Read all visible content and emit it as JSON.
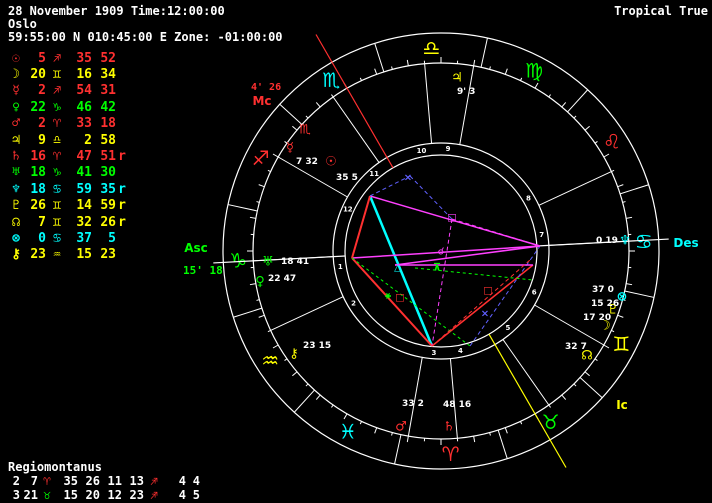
{
  "header": {
    "line1": "28 November 1909 Time:12:00:00",
    "line2": "Oslo",
    "line3": "59:55:00 N 010:45:00 E Zone: -01:00:00",
    "mode": "Tropical True"
  },
  "planets": [
    {
      "glyph": "☉",
      "color": "#ff3030",
      "deg": "5",
      "sign": "♐",
      "sign_color": "#ff3030",
      "min": "35",
      "sec": "52",
      "r": ""
    },
    {
      "glyph": "☽",
      "color": "#ffff00",
      "deg": "20",
      "sign": "♊",
      "sign_color": "#ffff00",
      "min": "16",
      "sec": "34",
      "r": ""
    },
    {
      "glyph": "☿",
      "color": "#ff3030",
      "deg": "2",
      "sign": "♐",
      "sign_color": "#ff3030",
      "min": "54",
      "sec": "31",
      "r": ""
    },
    {
      "glyph": "♀",
      "color": "#00ff00",
      "deg": "22",
      "sign": "♑",
      "sign_color": "#00ff00",
      "min": "46",
      "sec": "42",
      "r": ""
    },
    {
      "glyph": "♂",
      "color": "#ff3030",
      "deg": "2",
      "sign": "♈",
      "sign_color": "#ff3030",
      "min": "33",
      "sec": "18",
      "r": ""
    },
    {
      "glyph": "♃",
      "color": "#ffff00",
      "deg": "9",
      "sign": "♎",
      "sign_color": "#ffff00",
      "min": "2",
      "sec": "58",
      "r": ""
    },
    {
      "glyph": "♄",
      "color": "#ff3030",
      "deg": "16",
      "sign": "♈",
      "sign_color": "#ff3030",
      "min": "47",
      "sec": "51",
      "r": "r"
    },
    {
      "glyph": "♅",
      "color": "#00ff00",
      "deg": "18",
      "sign": "♑",
      "sign_color": "#00ff00",
      "min": "41",
      "sec": "30",
      "r": ""
    },
    {
      "glyph": "♆",
      "color": "#00ffff",
      "deg": "18",
      "sign": "♋",
      "sign_color": "#00ffff",
      "min": "59",
      "sec": "35",
      "r": "r"
    },
    {
      "glyph": "♇",
      "color": "#ffff00",
      "deg": "26",
      "sign": "♊",
      "sign_color": "#ffff00",
      "min": "14",
      "sec": "59",
      "r": "r"
    },
    {
      "glyph": "☊",
      "color": "#ffff00",
      "deg": "7",
      "sign": "♊",
      "sign_color": "#ffff00",
      "min": "32",
      "sec": "26",
      "r": "r"
    },
    {
      "glyph": "⊗",
      "color": "#00ffff",
      "deg": "0",
      "sign": "♋",
      "sign_color": "#00ffff",
      "min": "37",
      "sec": "5",
      "r": ""
    },
    {
      "glyph": "⚷",
      "color": "#ffff00",
      "deg": "23",
      "sign": "♒",
      "sign_color": "#ffff00",
      "min": "15",
      "sec": "23",
      "r": ""
    }
  ],
  "house_system": "Regiomontanus",
  "house_rows": [
    [
      {
        "text": "2",
        "color": "#ffffff"
      },
      {
        "text": "7",
        "color": "#ffffff"
      },
      {
        "text": "♈",
        "color": "#ff3030"
      },
      {
        "text": "35",
        "color": "#ffffff"
      },
      {
        "text": "26",
        "color": "#ffffff"
      },
      {
        "text": "11",
        "color": "#ffffff"
      },
      {
        "text": "13",
        "color": "#ffffff"
      },
      {
        "text": "♐",
        "color": "#ff3030"
      },
      {
        "text": "4",
        "color": "#ffffff"
      },
      {
        "text": "4",
        "color": "#ffffff"
      }
    ],
    [
      {
        "text": "3",
        "color": "#ffffff"
      },
      {
        "text": "21",
        "color": "#ffffff"
      },
      {
        "text": "♉",
        "color": "#00ff00"
      },
      {
        "text": "15",
        "color": "#ffffff"
      },
      {
        "text": "20",
        "color": "#ffffff"
      },
      {
        "text": "12",
        "color": "#ffffff"
      },
      {
        "text": "23",
        "color": "#ffffff"
      },
      {
        "text": "♐",
        "color": "#ff3030"
      },
      {
        "text": "4",
        "color": "#ffffff"
      },
      {
        "text": "5",
        "color": "#ffffff"
      }
    ]
  ],
  "wheel": {
    "signs": [
      {
        "glyph": "♈",
        "color": "#ff3030"
      },
      {
        "glyph": "♉",
        "color": "#00ff00"
      },
      {
        "glyph": "♊",
        "color": "#ffff00"
      },
      {
        "glyph": "♋",
        "color": "#00ffff"
      },
      {
        "glyph": "♌",
        "color": "#ff3030"
      },
      {
        "glyph": "♍",
        "color": "#00ff00"
      },
      {
        "glyph": "♎",
        "color": "#ffff00"
      },
      {
        "glyph": "♏",
        "color": "#00ffff"
      },
      {
        "glyph": "♐",
        "color": "#ff3030"
      },
      {
        "glyph": "♑",
        "color": "#00ff00"
      },
      {
        "glyph": "♒",
        "color": "#ffff00"
      },
      {
        "glyph": "♓",
        "color": "#00ffff"
      }
    ],
    "angles": {
      "asc": "Asc",
      "asc_pos": "15' 18",
      "des": "Des",
      "mc": "Mc",
      "mc_pos": "4' 26",
      "ic": "Ic"
    },
    "house_numbers": [
      "1",
      "2",
      "3",
      "4",
      "5",
      "6",
      "7",
      "8",
      "9",
      "10",
      "11",
      "12"
    ],
    "planet_labels": [
      {
        "glyph": "♃",
        "color": "#ffff00",
        "pos": "9' 3"
      },
      {
        "glyph": "♆",
        "color": "#00ffff",
        "pos": "0 19"
      },
      {
        "glyph": "⊗",
        "color": "#00ffff",
        "pos": "37 0"
      },
      {
        "glyph": "♇",
        "color": "#ffff00",
        "pos": "15 26"
      },
      {
        "glyph": "☽",
        "color": "#ffff00",
        "pos": "17 20"
      },
      {
        "glyph": "☊",
        "color": "#ffff00",
        "pos": "32 7"
      },
      {
        "glyph": "♄",
        "color": "#ff3030",
        "pos": "48 16"
      },
      {
        "glyph": "♂",
        "color": "#ff3030",
        "pos": "33 2"
      },
      {
        "glyph": "⚷",
        "color": "#ffff00",
        "pos": "23 15"
      },
      {
        "glyph": "♀",
        "color": "#00ff00",
        "pos": "22 47"
      },
      {
        "glyph": "♅",
        "color": "#00ff00",
        "pos": "18 41"
      },
      {
        "glyph": "☉",
        "color": "#ff3030",
        "pos": "35 5"
      },
      {
        "glyph": "☿",
        "color": "#ff3030",
        "pos": "7 32"
      },
      {
        "glyph": "♏",
        "color": "#ff3030",
        "pos": ""
      }
    ]
  }
}
